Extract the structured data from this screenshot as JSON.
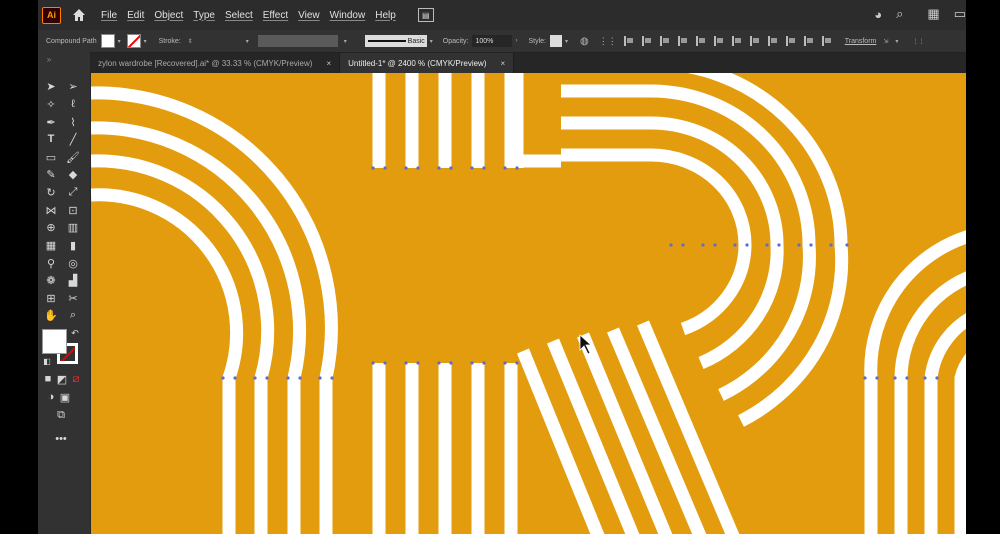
{
  "app": {
    "logo": "Ai"
  },
  "menu": [
    "File",
    "Edit",
    "Object",
    "Type",
    "Select",
    "Effect",
    "View",
    "Window",
    "Help"
  ],
  "control_bar": {
    "selection_type": "Compound Path",
    "stroke_label": "Stroke:",
    "brush": "Basic",
    "opacity_label": "Opacity:",
    "opacity_value": "100%",
    "style_label": "Style:",
    "transform_label": "Transform"
  },
  "tabs": [
    {
      "label": "zylon wardrobe [Recovered].ai* @ 33.33 % (CMYK/Preview)",
      "close": "×",
      "active": false
    },
    {
      "label": "Untitled-1* @ 2400 % (CMYK/Preview)",
      "close": "×",
      "active": true
    }
  ],
  "colors": {
    "artboard": "#e39c0d",
    "stripe": "#ffffff",
    "anchor": "#5b6bd6"
  },
  "icons": [
    "home-icon",
    "arrange-docs-icon",
    "user-icon",
    "search-icon",
    "workspace-icon",
    "cloud-icon",
    "selection-tool-icon",
    "direct-selection-tool-icon",
    "magic-wand-icon",
    "lasso-icon",
    "pen-tool-icon",
    "curvature-icon",
    "type-tool-icon",
    "line-tool-icon",
    "rectangle-tool-icon",
    "paintbrush-icon",
    "shaper-icon",
    "eraser-icon",
    "rotate-icon",
    "scale-icon",
    "width-tool-icon",
    "free-transform-icon",
    "shape-builder-icon",
    "perspective-icon",
    "mesh-icon",
    "gradient-icon",
    "eyedropper-icon",
    "blend-icon",
    "symbol-sprayer-icon",
    "column-graph-icon",
    "artboard-tool-icon",
    "slice-icon",
    "hand-tool-icon",
    "zoom-tool-icon",
    "fill-swatch",
    "stroke-swatch",
    "swap-icon",
    "default-colors-icon",
    "edit-toolbar-icon"
  ]
}
